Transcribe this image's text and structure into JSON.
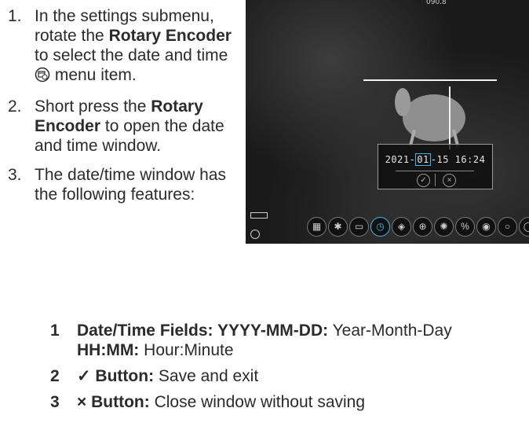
{
  "steps": [
    {
      "num": "1.",
      "pre": "In the settings submenu, rotate the ",
      "bold": "Rotary Encoder",
      "post": " to select the date and time ",
      "icon": "calendar-clock-icon",
      "tail": " menu item."
    },
    {
      "num": "2.",
      "pre": "Short press the ",
      "bold": "Rotary Encoder",
      "post": " to open the date and time window."
    },
    {
      "num": "3.",
      "pre": "The date/time window has the following features:"
    }
  ],
  "screen": {
    "top_label": "090.8",
    "datetime": {
      "year": "2021-",
      "month": "01",
      "rest": "-15   16:24"
    },
    "confirm_icon": "check-circle-icon",
    "cancel_icon": "x-circle-icon",
    "menu_icons": [
      "grid-icon",
      "bluetooth-icon",
      "image-icon",
      "date-time-icon",
      "compass-icon",
      "crosshair-icon",
      "settings-icon",
      "percent-icon",
      "sensor-icon",
      "circle-icon",
      "info-icon"
    ],
    "active_index": 3
  },
  "features": [
    {
      "num": "1",
      "label": "Date/Time Fields: YYYY-MM-DD:",
      "desc": " Year-Month-Day",
      "label2": "HH:MM:",
      "desc2": " Hour:Minute"
    },
    {
      "num": "2",
      "label": "✓ Button:",
      "desc": " Save and exit"
    },
    {
      "num": "3",
      "label": "× Button:",
      "desc": " Close window without saving"
    }
  ]
}
